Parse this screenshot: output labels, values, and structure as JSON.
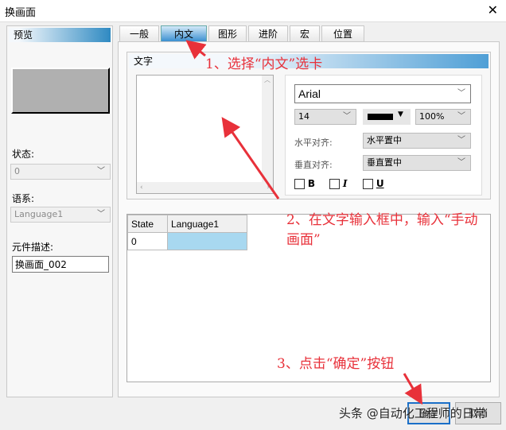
{
  "window": {
    "title": "换画面"
  },
  "left": {
    "preview_label": "预览",
    "state_label": "状态:",
    "state_value": "0",
    "language_label": "语系:",
    "language_value": "Language1",
    "desc_label": "元件描述:",
    "desc_value": "换画面_002"
  },
  "tabs": [
    "一般",
    "内文",
    "图形",
    "进阶",
    "宏",
    "位置"
  ],
  "text_group": {
    "title": "文字",
    "font": "Arial",
    "size": "14",
    "opacity": "100%",
    "h_align_label": "水平对齐:",
    "h_align_value": "水平置中",
    "v_align_label": "垂直对齐:",
    "v_align_value": "垂直置中",
    "bold": "B",
    "italic": "I",
    "underline": "U"
  },
  "table": {
    "headers": [
      "State",
      "Language1"
    ],
    "rows": [
      [
        "0",
        ""
      ]
    ]
  },
  "buttons": {
    "ok": "确定",
    "cancel": "取消"
  },
  "annotations": {
    "step1": "1、选择“内文”选卡",
    "step2_line1": "2、在文字输入框中，输入“手动",
    "step2_line2": "画面”",
    "step3": "3、点击“确定”按钮"
  },
  "watermark": "头条 @自动化工程师的日常",
  "colors": {
    "accent": "#2f8ac2",
    "annotation": "#e8313a",
    "selected_cell": "#a8d8f0"
  }
}
